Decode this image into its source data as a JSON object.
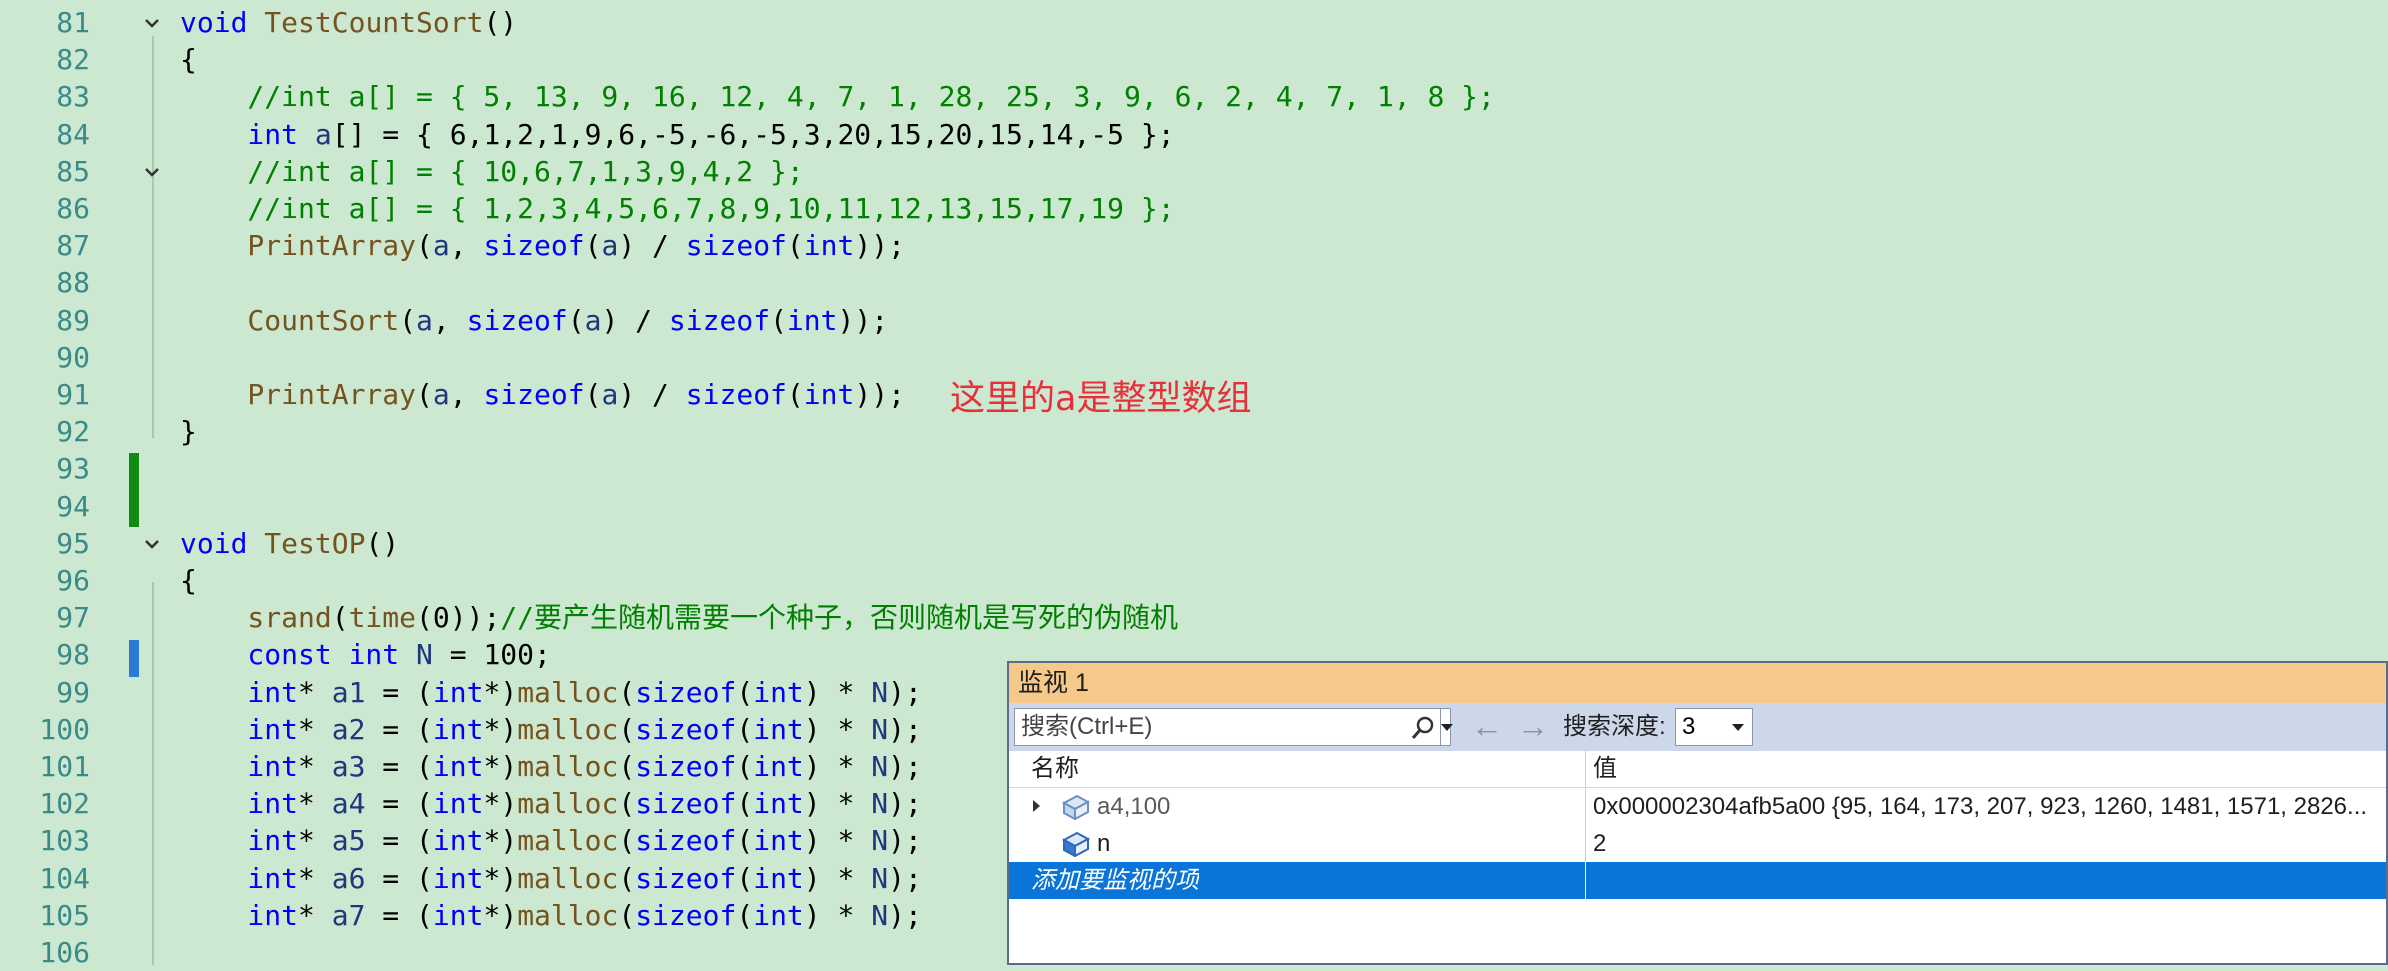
{
  "editor": {
    "lines": [
      {
        "num": "81",
        "tokens": [
          [
            "k",
            "void "
          ],
          [
            "f",
            "TestCountSort"
          ],
          [
            "n",
            "()"
          ]
        ],
        "fold": true
      },
      {
        "num": "82",
        "tokens": [
          [
            "n",
            "{"
          ]
        ]
      },
      {
        "num": "83",
        "tokens": [
          [
            "c",
            "    //int a[] = { 5, 13, 9, 16, 12, 4, 7, 1, 28, 25, 3, 9, 6, 2, 4, 7, 1, 8 };"
          ]
        ]
      },
      {
        "num": "84",
        "tokens": [
          [
            "k",
            "    int "
          ],
          [
            "v",
            "a"
          ],
          [
            "n",
            "[] = { 6,1,2,1,9,6,-5,-6,-5,3,20,15,20,15,14,-5 };"
          ]
        ]
      },
      {
        "num": "85",
        "tokens": [
          [
            "c",
            "    //int a[] = { 10,6,7,1,3,9,4,2 };"
          ]
        ],
        "fold": true
      },
      {
        "num": "86",
        "tokens": [
          [
            "c",
            "    //int a[] = { 1,2,3,4,5,6,7,8,9,10,11,12,13,15,17,19 };"
          ]
        ]
      },
      {
        "num": "87",
        "tokens": [
          [
            "f",
            "    PrintArray"
          ],
          [
            "n",
            "("
          ],
          [
            "v",
            "a"
          ],
          [
            "n",
            ", "
          ],
          [
            "k",
            "sizeof"
          ],
          [
            "n",
            "("
          ],
          [
            "v",
            "a"
          ],
          [
            "n",
            ") / "
          ],
          [
            "k",
            "sizeof"
          ],
          [
            "n",
            "("
          ],
          [
            "k",
            "int"
          ],
          [
            "n",
            "));"
          ]
        ]
      },
      {
        "num": "88",
        "tokens": []
      },
      {
        "num": "89",
        "tokens": [
          [
            "f",
            "    CountSort"
          ],
          [
            "n",
            "("
          ],
          [
            "v",
            "a"
          ],
          [
            "n",
            ", "
          ],
          [
            "k",
            "sizeof"
          ],
          [
            "n",
            "("
          ],
          [
            "v",
            "a"
          ],
          [
            "n",
            ") / "
          ],
          [
            "k",
            "sizeof"
          ],
          [
            "n",
            "("
          ],
          [
            "k",
            "int"
          ],
          [
            "n",
            "));"
          ]
        ]
      },
      {
        "num": "90",
        "tokens": []
      },
      {
        "num": "91",
        "tokens": [
          [
            "f",
            "    PrintArray"
          ],
          [
            "n",
            "("
          ],
          [
            "v",
            "a"
          ],
          [
            "n",
            ", "
          ],
          [
            "k",
            "sizeof"
          ],
          [
            "n",
            "("
          ],
          [
            "v",
            "a"
          ],
          [
            "n",
            ") / "
          ],
          [
            "k",
            "sizeof"
          ],
          [
            "n",
            "("
          ],
          [
            "k",
            "int"
          ],
          [
            "n",
            "));"
          ]
        ]
      },
      {
        "num": "92",
        "tokens": [
          [
            "n",
            "}"
          ]
        ]
      },
      {
        "num": "93",
        "tokens": []
      },
      {
        "num": "94",
        "tokens": []
      },
      {
        "num": "95",
        "tokens": [
          [
            "k",
            "void "
          ],
          [
            "f",
            "TestOP"
          ],
          [
            "n",
            "()"
          ]
        ],
        "fold": true
      },
      {
        "num": "96",
        "tokens": [
          [
            "n",
            "{"
          ]
        ]
      },
      {
        "num": "97",
        "tokens": [
          [
            "f",
            "    srand"
          ],
          [
            "n",
            "("
          ],
          [
            "f",
            "time"
          ],
          [
            "n",
            "(0));"
          ],
          [
            "c",
            "//要产生随机需要一个种子，否则随机是写死的伪随机"
          ]
        ]
      },
      {
        "num": "98",
        "tokens": [
          [
            "k",
            "    const int "
          ],
          [
            "v",
            "N"
          ],
          [
            "n",
            " = 100;"
          ]
        ]
      },
      {
        "num": "99",
        "tokens": [
          [
            "k",
            "    int"
          ],
          [
            "n",
            "* "
          ],
          [
            "v",
            "a1"
          ],
          [
            "n",
            " = ("
          ],
          [
            "k",
            "int"
          ],
          [
            "n",
            "*)"
          ],
          [
            "f",
            "malloc"
          ],
          [
            "n",
            "("
          ],
          [
            "k",
            "sizeof"
          ],
          [
            "n",
            "("
          ],
          [
            "k",
            "int"
          ],
          [
            "n",
            ") * "
          ],
          [
            "v",
            "N"
          ],
          [
            "n",
            ");"
          ]
        ]
      },
      {
        "num": "100",
        "tokens": [
          [
            "k",
            "    int"
          ],
          [
            "n",
            "* "
          ],
          [
            "v",
            "a2"
          ],
          [
            "n",
            " = ("
          ],
          [
            "k",
            "int"
          ],
          [
            "n",
            "*)"
          ],
          [
            "f",
            "malloc"
          ],
          [
            "n",
            "("
          ],
          [
            "k",
            "sizeof"
          ],
          [
            "n",
            "("
          ],
          [
            "k",
            "int"
          ],
          [
            "n",
            ") * "
          ],
          [
            "v",
            "N"
          ],
          [
            "n",
            ");"
          ]
        ]
      },
      {
        "num": "101",
        "tokens": [
          [
            "k",
            "    int"
          ],
          [
            "n",
            "* "
          ],
          [
            "v",
            "a3"
          ],
          [
            "n",
            " = ("
          ],
          [
            "k",
            "int"
          ],
          [
            "n",
            "*)"
          ],
          [
            "f",
            "malloc"
          ],
          [
            "n",
            "("
          ],
          [
            "k",
            "sizeof"
          ],
          [
            "n",
            "("
          ],
          [
            "k",
            "int"
          ],
          [
            "n",
            ") * "
          ],
          [
            "v",
            "N"
          ],
          [
            "n",
            ");"
          ]
        ]
      },
      {
        "num": "102",
        "tokens": [
          [
            "k",
            "    int"
          ],
          [
            "n",
            "* "
          ],
          [
            "v",
            "a4"
          ],
          [
            "n",
            " = ("
          ],
          [
            "k",
            "int"
          ],
          [
            "n",
            "*)"
          ],
          [
            "f",
            "malloc"
          ],
          [
            "n",
            "("
          ],
          [
            "k",
            "sizeof"
          ],
          [
            "n",
            "("
          ],
          [
            "k",
            "int"
          ],
          [
            "n",
            ") * "
          ],
          [
            "v",
            "N"
          ],
          [
            "n",
            ");"
          ]
        ]
      },
      {
        "num": "103",
        "tokens": [
          [
            "k",
            "    int"
          ],
          [
            "n",
            "* "
          ],
          [
            "v",
            "a5"
          ],
          [
            "n",
            " = ("
          ],
          [
            "k",
            "int"
          ],
          [
            "n",
            "*)"
          ],
          [
            "f",
            "malloc"
          ],
          [
            "n",
            "("
          ],
          [
            "k",
            "sizeof"
          ],
          [
            "n",
            "("
          ],
          [
            "k",
            "int"
          ],
          [
            "n",
            ") * "
          ],
          [
            "v",
            "N"
          ],
          [
            "n",
            ");"
          ]
        ]
      },
      {
        "num": "104",
        "tokens": [
          [
            "k",
            "    int"
          ],
          [
            "n",
            "* "
          ],
          [
            "v",
            "a6"
          ],
          [
            "n",
            " = ("
          ],
          [
            "k",
            "int"
          ],
          [
            "n",
            "*)"
          ],
          [
            "f",
            "malloc"
          ],
          [
            "n",
            "("
          ],
          [
            "k",
            "sizeof"
          ],
          [
            "n",
            "("
          ],
          [
            "k",
            "int"
          ],
          [
            "n",
            ") * "
          ],
          [
            "v",
            "N"
          ],
          [
            "n",
            ");"
          ]
        ]
      },
      {
        "num": "105",
        "tokens": [
          [
            "k",
            "    int"
          ],
          [
            "n",
            "* "
          ],
          [
            "v",
            "a7"
          ],
          [
            "n",
            " = ("
          ],
          [
            "k",
            "int"
          ],
          [
            "n",
            "*)"
          ],
          [
            "f",
            "malloc"
          ],
          [
            "n",
            "("
          ],
          [
            "k",
            "sizeof"
          ],
          [
            "n",
            "("
          ],
          [
            "k",
            "int"
          ],
          [
            "n",
            ") * "
          ],
          [
            "v",
            "N"
          ],
          [
            "n",
            ");"
          ]
        ]
      },
      {
        "num": "106",
        "tokens": []
      }
    ],
    "annotation": "这里的a是整型数组"
  },
  "watch": {
    "title": "监视 1",
    "search_placeholder": "搜索(Ctrl+E)",
    "depth_label": "搜索深度:",
    "depth_value": "3",
    "columns": {
      "name": "名称",
      "value": "值"
    },
    "rows": [
      {
        "name": "a4,100",
        "value": "0x000002304afb5a00 {95, 164, 173, 207, 923, 1260, 1481, 1571, 2826..."
      },
      {
        "name": "n",
        "value": "2"
      }
    ],
    "add_item": "添加要监视的项"
  },
  "colors": {
    "editor_bg": "#cde8d0",
    "keyword": "#0000ff",
    "comment": "#008000",
    "annotation": "#e8303a",
    "watch_title_bg": "#f5c98a",
    "selection": "#0a74d8"
  }
}
